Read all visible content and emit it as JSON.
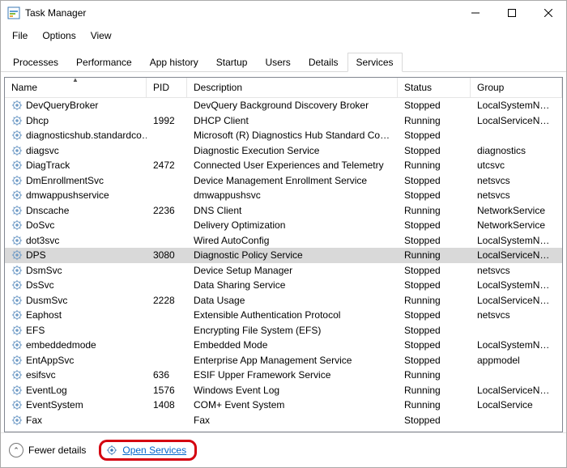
{
  "window": {
    "title": "Task Manager"
  },
  "menu": {
    "file": "File",
    "options": "Options",
    "view": "View"
  },
  "tabs": {
    "processes": "Processes",
    "performance": "Performance",
    "apphistory": "App history",
    "startup": "Startup",
    "users": "Users",
    "details": "Details",
    "services": "Services"
  },
  "columns": {
    "name": "Name",
    "pid": "PID",
    "description": "Description",
    "status": "Status",
    "group": "Group"
  },
  "rows": [
    {
      "name": "DevQueryBroker",
      "pid": "",
      "desc": "DevQuery Background Discovery Broker",
      "status": "Stopped",
      "group": "LocalSystemN…"
    },
    {
      "name": "Dhcp",
      "pid": "1992",
      "desc": "DHCP Client",
      "status": "Running",
      "group": "LocalServiceN…"
    },
    {
      "name": "diagnosticshub.standardco…",
      "pid": "",
      "desc": "Microsoft (R) Diagnostics Hub Standard Coll…",
      "status": "Stopped",
      "group": ""
    },
    {
      "name": "diagsvc",
      "pid": "",
      "desc": "Diagnostic Execution Service",
      "status": "Stopped",
      "group": "diagnostics"
    },
    {
      "name": "DiagTrack",
      "pid": "2472",
      "desc": "Connected User Experiences and Telemetry",
      "status": "Running",
      "group": "utcsvc"
    },
    {
      "name": "DmEnrollmentSvc",
      "pid": "",
      "desc": "Device Management Enrollment Service",
      "status": "Stopped",
      "group": "netsvcs"
    },
    {
      "name": "dmwappushservice",
      "pid": "",
      "desc": "dmwappushsvc",
      "status": "Stopped",
      "group": "netsvcs"
    },
    {
      "name": "Dnscache",
      "pid": "2236",
      "desc": "DNS Client",
      "status": "Running",
      "group": "NetworkService"
    },
    {
      "name": "DoSvc",
      "pid": "",
      "desc": "Delivery Optimization",
      "status": "Stopped",
      "group": "NetworkService"
    },
    {
      "name": "dot3svc",
      "pid": "",
      "desc": "Wired AutoConfig",
      "status": "Stopped",
      "group": "LocalSystemN…"
    },
    {
      "name": "DPS",
      "pid": "3080",
      "desc": "Diagnostic Policy Service",
      "status": "Running",
      "group": "LocalServiceN…",
      "selected": true
    },
    {
      "name": "DsmSvc",
      "pid": "",
      "desc": "Device Setup Manager",
      "status": "Stopped",
      "group": "netsvcs"
    },
    {
      "name": "DsSvc",
      "pid": "",
      "desc": "Data Sharing Service",
      "status": "Stopped",
      "group": "LocalSystemN…"
    },
    {
      "name": "DusmSvc",
      "pid": "2228",
      "desc": "Data Usage",
      "status": "Running",
      "group": "LocalServiceN…"
    },
    {
      "name": "Eaphost",
      "pid": "",
      "desc": "Extensible Authentication Protocol",
      "status": "Stopped",
      "group": "netsvcs"
    },
    {
      "name": "EFS",
      "pid": "",
      "desc": "Encrypting File System (EFS)",
      "status": "Stopped",
      "group": ""
    },
    {
      "name": "embeddedmode",
      "pid": "",
      "desc": "Embedded Mode",
      "status": "Stopped",
      "group": "LocalSystemN…"
    },
    {
      "name": "EntAppSvc",
      "pid": "",
      "desc": "Enterprise App Management Service",
      "status": "Stopped",
      "group": "appmodel"
    },
    {
      "name": "esifsvc",
      "pid": "636",
      "desc": "ESIF Upper Framework Service",
      "status": "Running",
      "group": ""
    },
    {
      "name": "EventLog",
      "pid": "1576",
      "desc": "Windows Event Log",
      "status": "Running",
      "group": "LocalServiceN…"
    },
    {
      "name": "EventSystem",
      "pid": "1408",
      "desc": "COM+ Event System",
      "status": "Running",
      "group": "LocalService"
    },
    {
      "name": "Fax",
      "pid": "",
      "desc": "Fax",
      "status": "Stopped",
      "group": ""
    }
  ],
  "footer": {
    "fewer": "Fewer details",
    "open": "Open Services"
  }
}
